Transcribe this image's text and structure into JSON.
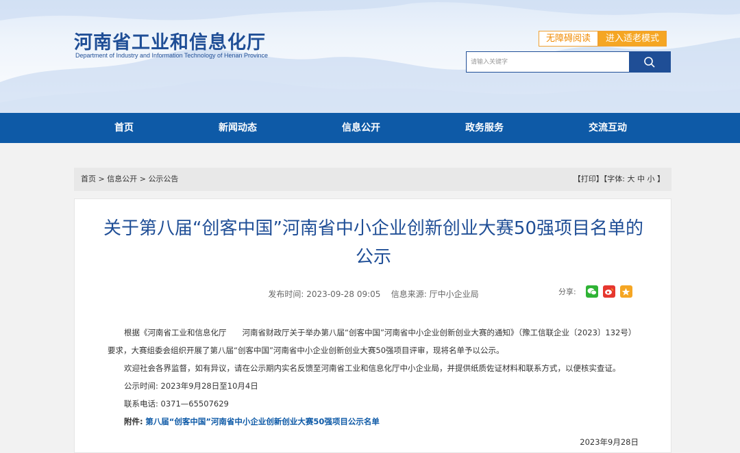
{
  "header": {
    "logo_cn": "河南省工业和信息化厅",
    "logo_en": "Department of Industry and Information Technology of Henan Province",
    "accessibility_label": "无障碍阅读",
    "elderly_mode_label": "进入适老模式",
    "search_placeholder": "请输入关键字"
  },
  "nav": {
    "items": [
      "首页",
      "新闻动态",
      "信息公开",
      "政务服务",
      "交流互动"
    ]
  },
  "breadcrumb": {
    "home": "首页",
    "sep1": " > ",
    "level1": "信息公开",
    "sep2": " > ",
    "level2": "公示公告",
    "tools": "【打印】【字体: 大 中 小 】"
  },
  "article": {
    "title": "关于第八届“创客中国”河南省中小企业创新创业大赛50强项目名单的公示",
    "publish_time_label": "发布时间:",
    "publish_time": "2023-09-28 09:05",
    "source_label": "信息来源:",
    "source": "厅中小企业局",
    "share_label": "分享:",
    "para1": "根据《河南省工业和信息化厅　　河南省财政厅关于举办第八届“创客中国”河南省中小企业创新创业大赛的通知》（豫工信联企业〔2023〕132号）要求，大赛组委会组织开展了第八届“创客中国”河南省中小企业创新创业大赛50强项目评审，现将名单予以公示。",
    "para2": "欢迎社会各界监督，如有异议，请在公示期内实名反馈至河南省工业和信息化厅中小企业局，并提供纸质佐证材料和联系方式，以便核实查证。",
    "period_label": "公示时间:",
    "period": "2023年9月28日至10月4日",
    "phone_label": "联系电话:",
    "phone": "0371—65507629",
    "attachment_label": "附件:",
    "attachment": "第八届“创客中国”河南省中小企业创新创业大赛50强项目公示名单",
    "date": "2023年9月28日"
  },
  "colors": {
    "brand_blue": "#1f4e96",
    "nav_blue": "#0e5aa7",
    "accent_orange": "#f5a623"
  }
}
